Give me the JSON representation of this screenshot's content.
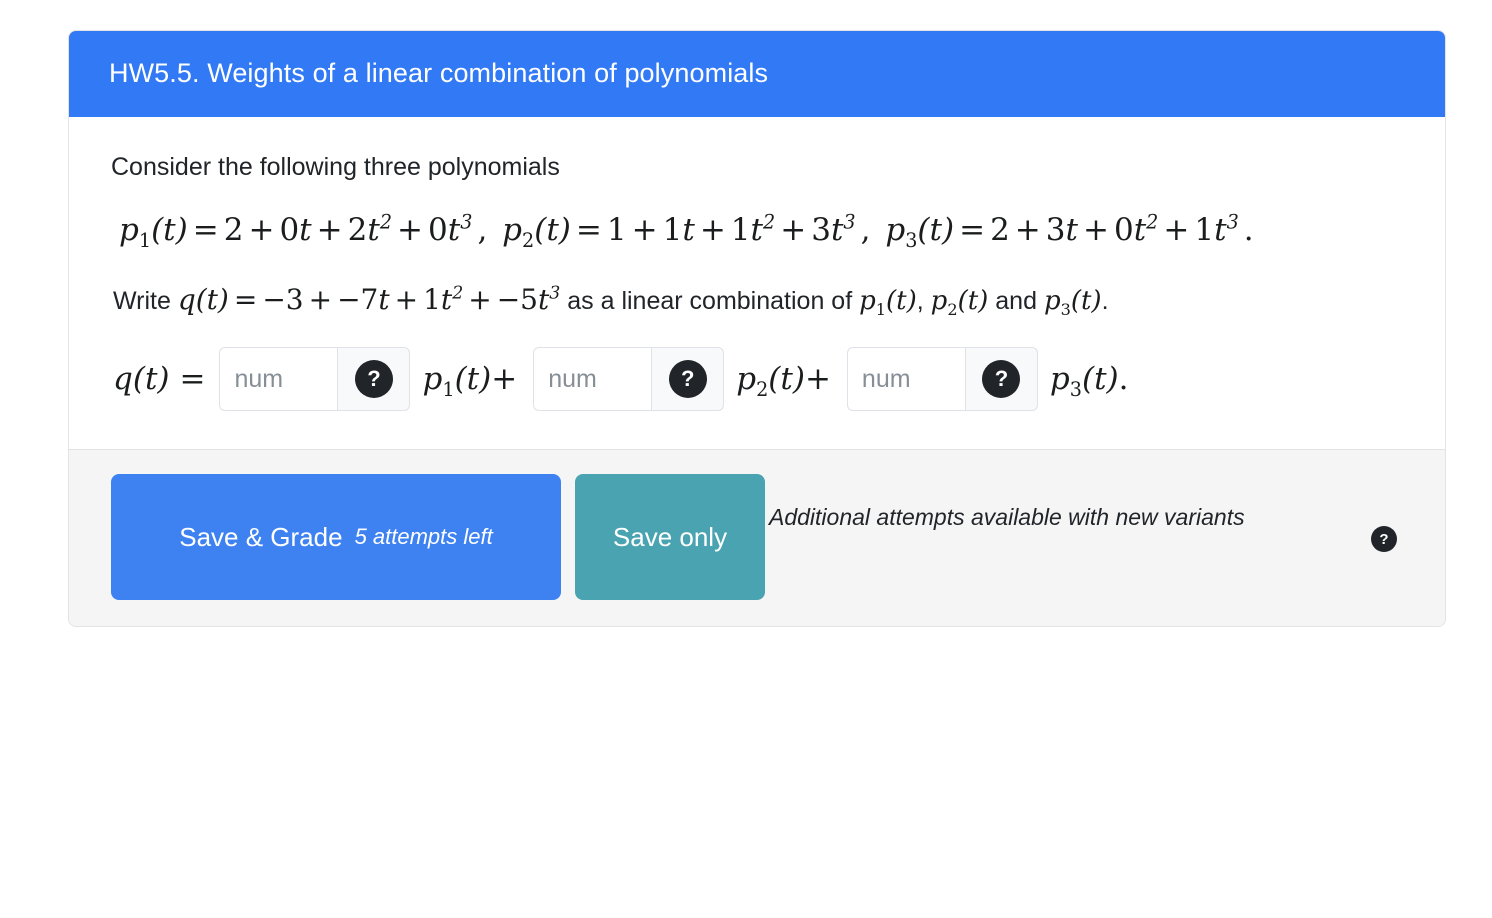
{
  "card": {
    "title": "HW5.5. Weights of a linear combination of polynomials",
    "header_color": "#3179f5"
  },
  "body": {
    "intro": "Consider the following three polynomials",
    "polynomials": {
      "p1": {
        "name": "p",
        "index": "1",
        "terms": [
          "2",
          "0t",
          "2t²",
          "0t³"
        ],
        "display": "p₁(t) = 2 + 0t + 2t² + 0t³"
      },
      "p2": {
        "name": "p",
        "index": "2",
        "terms": [
          "1",
          "1t",
          "1t²",
          "3t³"
        ],
        "display": "p₂(t) = 1 + 1t + 1t² + 3t³"
      },
      "p3": {
        "name": "p",
        "index": "3",
        "terms": [
          "2",
          "3t",
          "0t²",
          "1t³"
        ],
        "display": "p₃(t) = 2 + 3t + 0t² + 1t³"
      }
    },
    "q_polynomial": {
      "terms": [
        "−3",
        "−7t",
        "1t²",
        "−5t³"
      ],
      "display": "q(t) = −3 + −7t + 1t² + −5t³"
    },
    "write_prefix": "Write",
    "write_middle": "as a linear combination of",
    "write_and": "and",
    "write_period": ".",
    "coefficients": {
      "c1": {
        "value": "",
        "placeholder": "num",
        "help_icon": "question-mark-icon",
        "term": "p₁(t)",
        "trailing_op": "+"
      },
      "c2": {
        "value": "",
        "placeholder": "num",
        "help_icon": "question-mark-icon",
        "term": "p₂(t)",
        "trailing_op": "+"
      },
      "c3": {
        "value": "",
        "placeholder": "num",
        "help_icon": "question-mark-icon",
        "term": "p₃(t)",
        "trailing_op": "."
      }
    },
    "answer_lhs": "q(t)",
    "answer_eq": "="
  },
  "footer": {
    "save_grade_label": "Save & Grade",
    "attempts_text": "5 attempts left",
    "save_only_label": "Save only",
    "variant_note": "Additional attempts available with new variants",
    "help_icon": "question-mark-icon",
    "help_glyph": "?",
    "grade_color": "#3e82f2",
    "save_color": "#4aa3b0"
  },
  "icons": {
    "question": "?"
  }
}
